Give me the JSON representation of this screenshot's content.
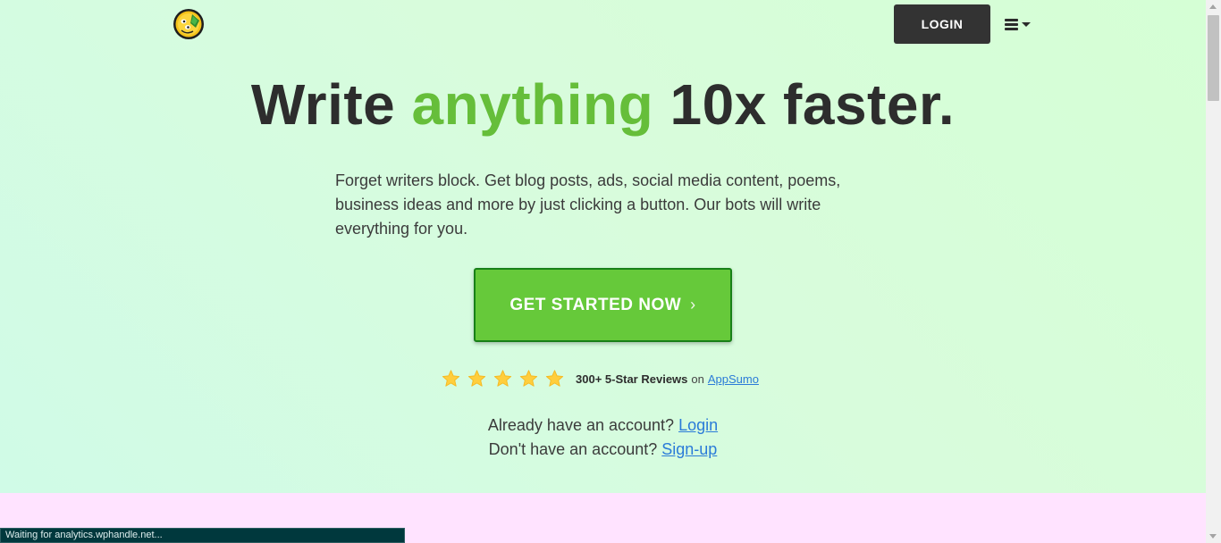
{
  "header": {
    "logo_icon": "smiley-face-logo-icon",
    "login_label": "LOGIN",
    "menu_icon": "hamburger-menu-icon"
  },
  "hero": {
    "headline_part1": "Write ",
    "headline_accent": "anything",
    "headline_part2": " 10x faster.",
    "subtext": "Forget writers block. Get blog posts, ads, social media content, poems, business ideas and more by just clicking a button. Our bots will write everything for you.",
    "cta_label": "GET STARTED NOW",
    "cta_chevron": "›",
    "review_stars": 5,
    "reviews_bold": "300+ 5-Star Reviews",
    "reviews_on": "on",
    "reviews_link": "AppSumo",
    "account_prompt": "Already have an account?",
    "account_login_link": "Login",
    "no_account_prompt": "Don't have an account?",
    "signup_link": "Sign-up"
  },
  "status_bar": {
    "text": "Waiting for analytics.wphandle.net..."
  },
  "colors": {
    "accent_green": "#66be3a",
    "cta_green": "#66c93a",
    "dark_button": "#333333",
    "star_yellow": "#ffce3d",
    "link_blue": "#2a7bd8",
    "pink_section": "#ffe3ff"
  }
}
